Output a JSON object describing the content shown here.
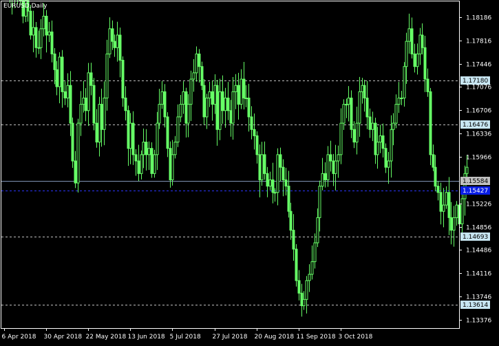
{
  "symbol_label": "EURUSD,Daily",
  "colors": {
    "background": "#000000",
    "frame": "#ffffff",
    "candle": "#66ff66",
    "level_line": "#c0c0c0",
    "level_tag": "#c8e6f2",
    "bid_line": "#7f93b5",
    "bid_tag": "#c0c0c0",
    "ask_line": "#2a35ff",
    "ask_tag": "#0a1ee6"
  },
  "chart_data": {
    "type": "candlestick",
    "series_name": "EURUSD,Daily",
    "ylim": [
      1.13245,
      1.18435
    ],
    "y_ticks": [
      "1.18186",
      "1.17816",
      "1.17446",
      "1.17076",
      "1.16706",
      "1.16336",
      "1.15966",
      "1.15226",
      "1.14856",
      "1.14486",
      "1.14116",
      "1.13746",
      "1.13376"
    ],
    "x_ticks": [
      "6 Apr 2018",
      "30 Apr 2018",
      "22 May 2018",
      "13 Jun 2018",
      "5 Jul 2018",
      "27 Jul 2018",
      "20 Aug 2018",
      "11 Sep 2018",
      "3 Oct 2018"
    ],
    "x_tick_index": [
      0,
      16,
      32,
      48,
      64,
      80,
      96,
      112,
      128
    ],
    "levels": [
      {
        "label": "1.17180",
        "value": 1.1718
      },
      {
        "label": "1.16476",
        "value": 1.16476
      },
      {
        "label": "1.14693",
        "value": 1.14693
      },
      {
        "label": "1.13614",
        "value": 1.13614
      }
    ],
    "bid": {
      "label": "1.15584",
      "value": 1.15584
    },
    "ask": {
      "label": "1.15427",
      "value": 1.15427
    },
    "closes": [
      1.1885,
      1.1878,
      1.1858,
      1.1848,
      1.1862,
      1.187,
      1.1845,
      1.182,
      1.1845,
      1.1828,
      1.179,
      1.1802,
      1.177,
      1.177,
      1.18,
      1.182,
      1.179,
      1.1795,
      1.176,
      1.1735,
      1.1708,
      1.1755,
      1.17,
      1.169,
      1.171,
      1.165,
      1.159,
      1.1555,
      1.165,
      1.168,
      1.169,
      1.167,
      1.173,
      1.171,
      1.165,
      1.162,
      1.168,
      1.164,
      1.169,
      1.176,
      1.18,
      1.178,
      1.177,
      1.179,
      1.175,
      1.169,
      1.167,
      1.161,
      1.165,
      1.16,
      1.159,
      1.157,
      1.16,
      1.162,
      1.16,
      1.161,
      1.157,
      1.16,
      1.165,
      1.168,
      1.17,
      1.166,
      1.161,
      1.156,
      1.16,
      1.162,
      1.166,
      1.168,
      1.17,
      1.165,
      1.168,
      1.172,
      1.173,
      1.176,
      1.174,
      1.171,
      1.166,
      1.169,
      1.17,
      1.168,
      1.171,
      1.164,
      1.17,
      1.167,
      1.169,
      1.167,
      1.165,
      1.17,
      1.171,
      1.168,
      1.172,
      1.169,
      1.169,
      1.166,
      1.164,
      1.163,
      1.16,
      1.156,
      1.16,
      1.157,
      1.155,
      1.156,
      1.154,
      1.154,
      1.16,
      1.158,
      1.156,
      1.155,
      1.151,
      1.148,
      1.145,
      1.14,
      1.138,
      1.136,
      1.137,
      1.14,
      1.141,
      1.143,
      1.146,
      1.15,
      1.155,
      1.157,
      1.156,
      1.16,
      1.159,
      1.157,
      1.159,
      1.16,
      1.165,
      1.168,
      1.168,
      1.169,
      1.164,
      1.162,
      1.165,
      1.17,
      1.171,
      1.169,
      1.166,
      1.164,
      1.165,
      1.16,
      1.162,
      1.163,
      1.161,
      1.158,
      1.159,
      1.164,
      1.165,
      1.168,
      1.169,
      1.169,
      1.174,
      1.178,
      1.18,
      1.176,
      1.174,
      1.176,
      1.179,
      1.177,
      1.172,
      1.17,
      1.16,
      1.158,
      1.155,
      1.154,
      1.151,
      1.152,
      1.154,
      1.15,
      1.148,
      1.15,
      1.152,
      1.149,
      1.153,
      1.157,
      1.158
    ]
  }
}
